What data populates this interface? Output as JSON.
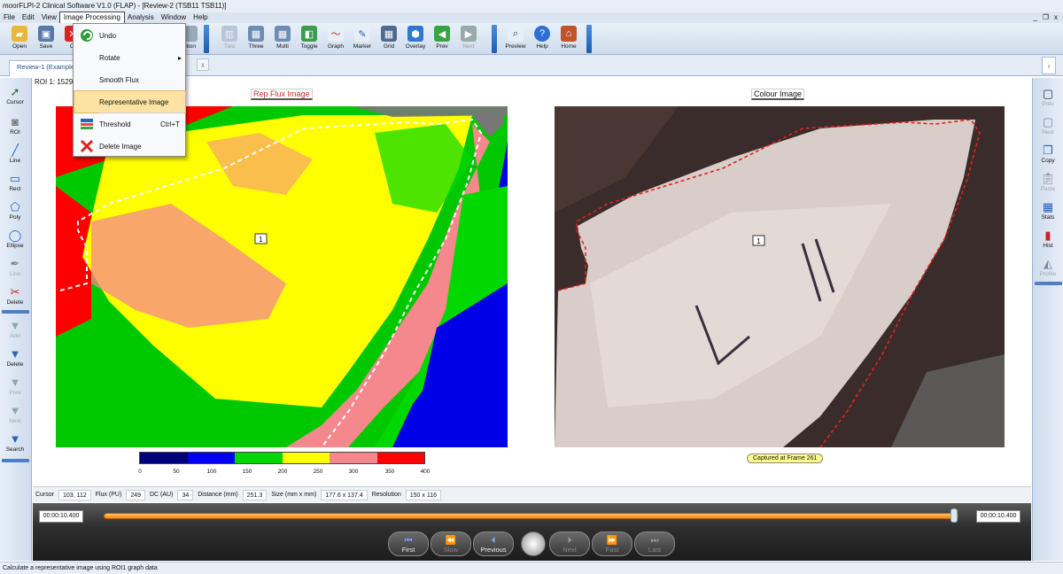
{
  "title": "moorFLPI-2 Clinical Software V1.0 (FLAP) - [Review-2 (TSB11 TSB11)]",
  "menu": [
    "File",
    "Edit",
    "View",
    "Image Processing",
    "Analysis",
    "Window",
    "Help"
  ],
  "mdi": {
    "min": "_",
    "restore": "❐",
    "close": "x"
  },
  "toolbar": {
    "open": "Open",
    "save": "Save",
    "close": "Cl",
    "option": "otion",
    "two": "Two",
    "three": "Three",
    "multi": "Multi",
    "toggle": "Toggle",
    "graph": "Graph",
    "marker": "Marker",
    "grid": "Grid",
    "overlay": "Overlay",
    "prev": "Prev",
    "next": "Next",
    "preview": "Preview",
    "help": "Help",
    "home": "Home"
  },
  "tab": {
    "label": "Review-1 (Example I",
    "close": "x",
    "scroll": "›"
  },
  "left_tools": [
    "Cursor",
    "ROI",
    "Line",
    "Rect",
    "Poly",
    "Ellipse",
    "Line",
    "Delete",
    "Add",
    "Delete",
    "Prev",
    "Next",
    "Search"
  ],
  "right_tools": [
    "Prev",
    "Next",
    "Copy",
    "Paste",
    "Stats",
    "Hist",
    "Profile"
  ],
  "roi_label": "ROI 1: 1529",
  "flux_title": "Rep Flux Image",
  "colour_title": "Colour Image",
  "roi_number": "1",
  "captured": "Captured at Frame 261",
  "scale": {
    "colors": [
      "#00007a",
      "#0000ee",
      "#00d800",
      "#ffff00",
      "#f5888c",
      "#ff0000"
    ],
    "labels": [
      "0",
      "50",
      "100",
      "150",
      "200",
      "250",
      "300",
      "350",
      "400"
    ]
  },
  "info": {
    "cursor_label": "Cursor",
    "cursor": "103, 112",
    "flux_label": "Flux (PU)",
    "flux": "249",
    "dc_label": "DC (AU)",
    "dc": "34",
    "distance_label": "Distance (mm)",
    "distance": "251.3",
    "size_label": "Size (mm x mm)",
    "size": "177.6 x 137.4",
    "resolution_label": "Resolution",
    "resolution": "150 x 116"
  },
  "player": {
    "time_left": "00:00:10.400",
    "time_right": "00:00:10.400",
    "position": 0.995,
    "buttons": {
      "first": "First",
      "slow": "Slow",
      "previous": "Previous",
      "next": "Next",
      "fast": "Fast",
      "last": "Last"
    }
  },
  "dropdown": {
    "undo": "Undo",
    "rotate": "Rotate",
    "smooth": "Smooth Flux",
    "representative": "Representative Image",
    "threshold": "Threshold",
    "threshold_key": "Ctrl+T",
    "delete": "Delete Image"
  },
  "status": "Calculate a representative image using ROI1 graph data"
}
